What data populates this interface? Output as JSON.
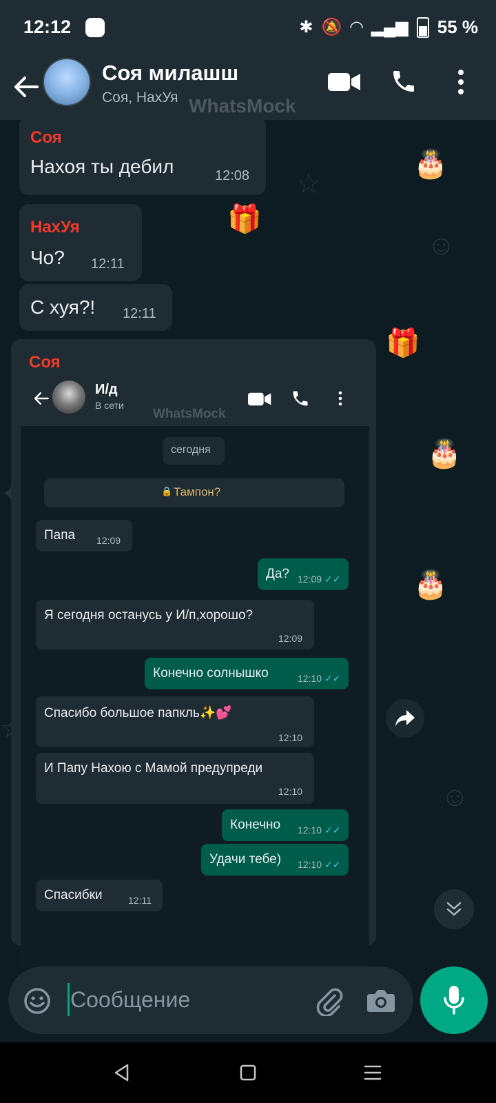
{
  "status_bar": {
    "time": "12:12",
    "battery": "55 %"
  },
  "header": {
    "title": "Соя милашш",
    "subtitle": "Соя, НахУя",
    "watermark": "WhatsMock"
  },
  "messages": [
    {
      "sender": "Соя",
      "text": "Нахоя ты дебил",
      "time": "12:08"
    },
    {
      "sender": "НахУя",
      "text": "Чо?",
      "time": "12:11"
    },
    {
      "text": "С хуя?!",
      "time": "12:11"
    },
    {
      "sender": "Соя"
    }
  ],
  "screenshot": {
    "header": {
      "title": "И/д",
      "status": "В сети",
      "watermark": "WhatsMock"
    },
    "date_chip": "сегодня",
    "pinned": "Тампон?",
    "messages": [
      {
        "text": "Папа",
        "time": "12:09",
        "outgoing": false
      },
      {
        "text": "Да?",
        "time": "12:09",
        "outgoing": true
      },
      {
        "text": "Я сегодня останусь у И/п,хорошо?",
        "time": "12:09",
        "outgoing": false
      },
      {
        "text": "Конечно солнышко",
        "time": "12:10",
        "outgoing": true
      },
      {
        "text": "Спасибо большое папкль✨💕",
        "time": "12:10",
        "outgoing": false
      },
      {
        "text": "И Папу Нахою с Мамой предупреди",
        "time": "12:10",
        "outgoing": false
      },
      {
        "text": "Конечно",
        "time": "12:10",
        "outgoing": true
      },
      {
        "text": "Удачи тебе)",
        "time": "12:10",
        "outgoing": true
      },
      {
        "text": "Спасибки",
        "time": "12:11",
        "outgoing": false
      }
    ]
  },
  "input": {
    "placeholder": "Сообщение"
  },
  "colors": {
    "sender_name": "#f23a2c",
    "outgoing_bubble": "#005c4b",
    "accent": "#00a884",
    "read_check": "#53bdeb"
  }
}
